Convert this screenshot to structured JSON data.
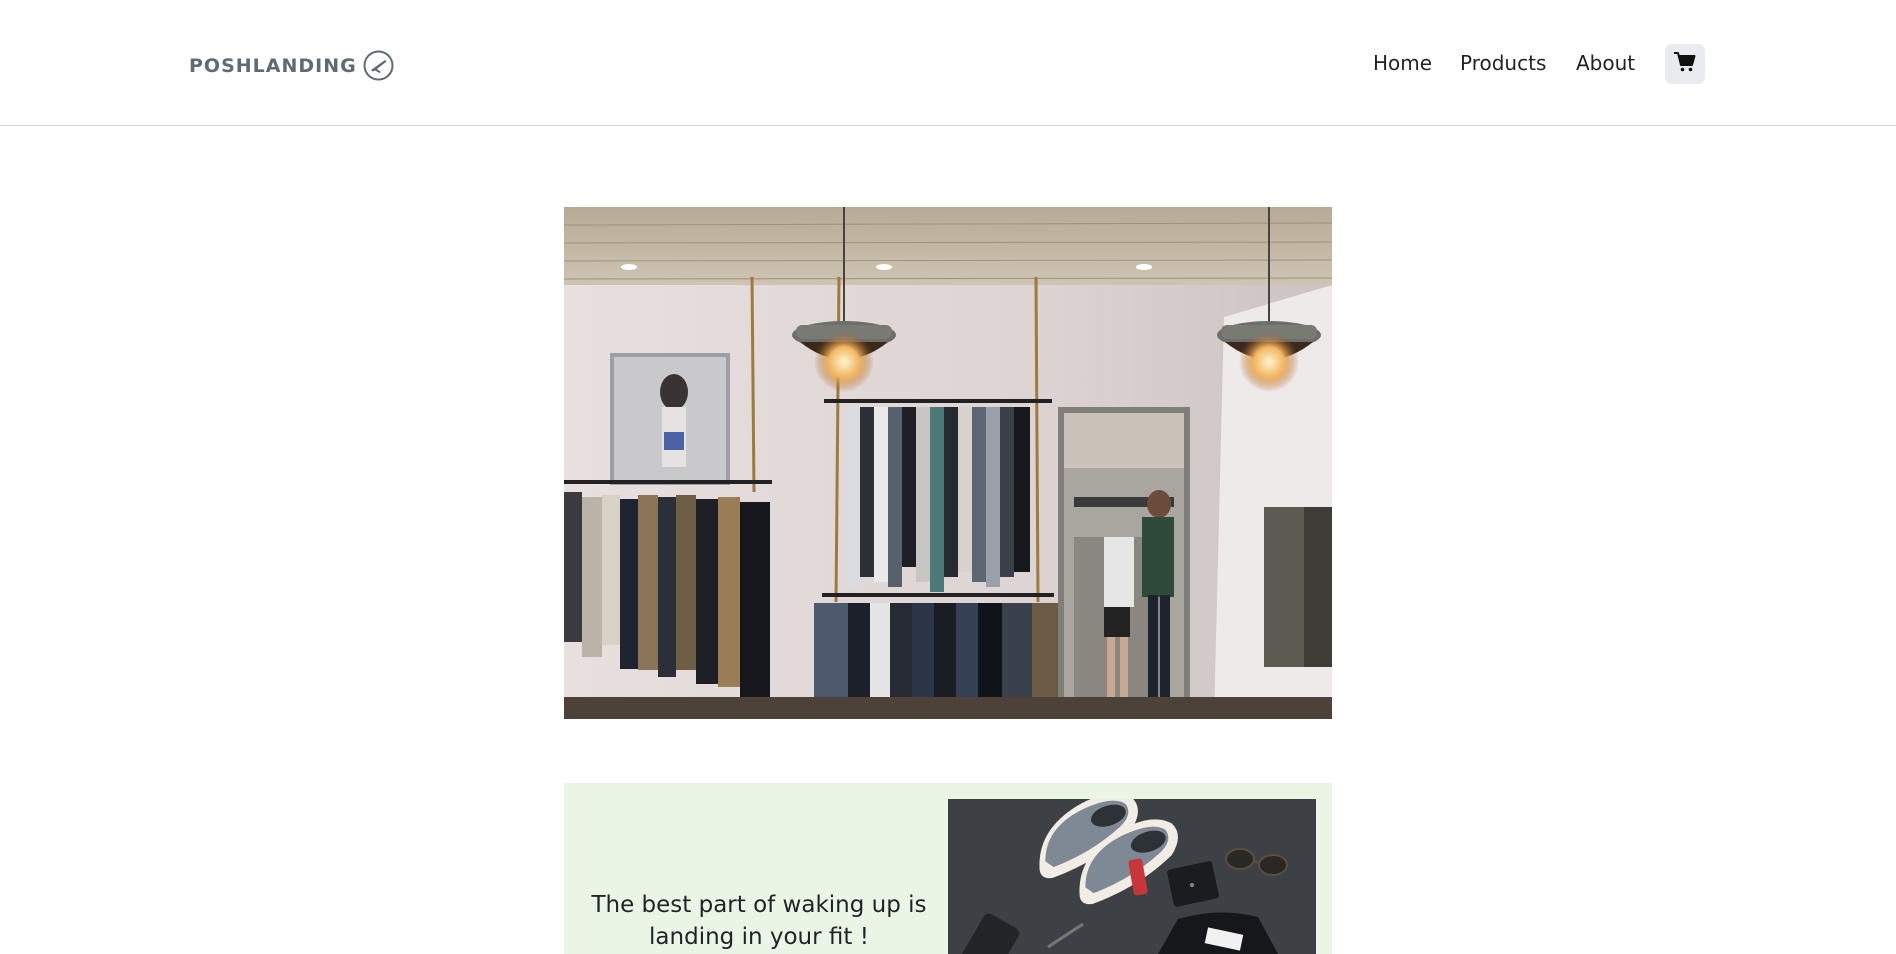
{
  "brand": {
    "name": "POSHLANDING",
    "logo_icon": "plane-circle-icon",
    "color": "#5d6b74"
  },
  "nav": {
    "items": [
      {
        "label": "Home"
      },
      {
        "label": "Products"
      },
      {
        "label": "About"
      }
    ],
    "cart_icon": "shopping-cart-icon"
  },
  "hero": {
    "image": "clothing-store-interior-photo"
  },
  "promo": {
    "text": "The best part of waking up is landing in your fit !",
    "image": "sneakers-flatlay-photo",
    "background": "#eaf5e6"
  }
}
